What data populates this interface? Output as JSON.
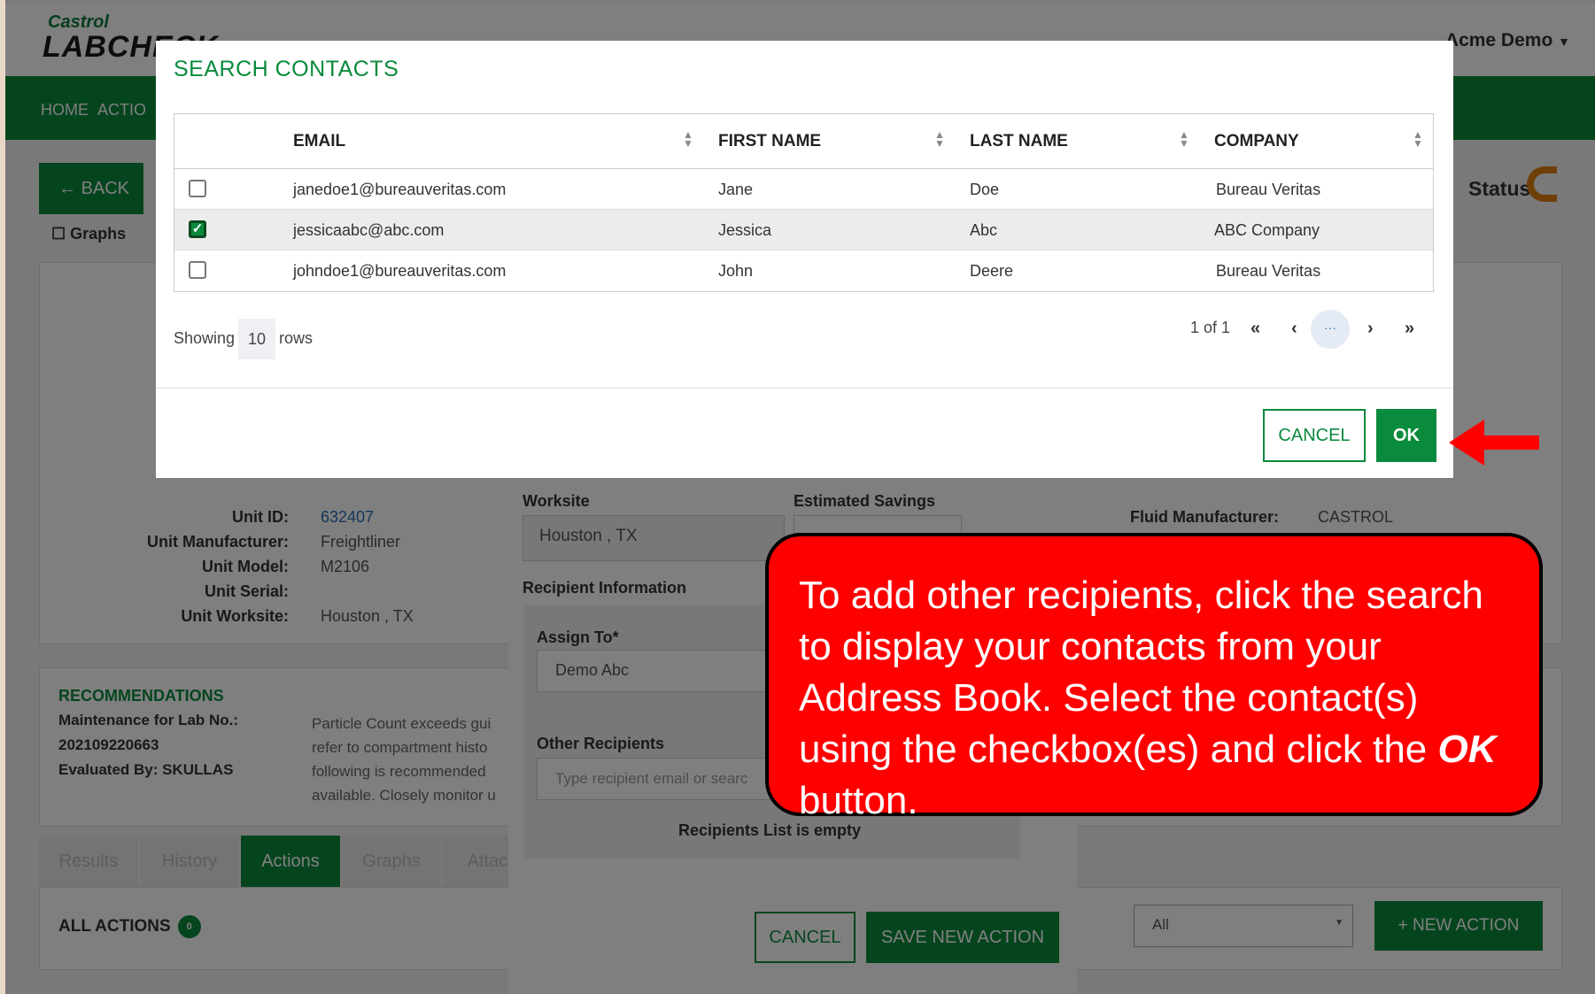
{
  "app": {
    "brand_top": "Castrol",
    "brand_main": "LABCHECK",
    "user": "Acme Demo",
    "nav": [
      "HOME",
      "ACTIO"
    ],
    "back_label": "BACK",
    "graphs_label": "Graphs",
    "status_label": "Status"
  },
  "unit_info": {
    "fields": [
      {
        "label": "Unit ID:",
        "value": "632407"
      },
      {
        "label": "Unit Manufacturer:",
        "value": "Freightliner"
      },
      {
        "label": "Unit Model:",
        "value": "M2106"
      },
      {
        "label": "Unit Serial:",
        "value": ""
      },
      {
        "label": "Unit Worksite:",
        "value": "Houston , TX"
      }
    ]
  },
  "fluid_info": {
    "label": "Fluid Manufacturer:",
    "value": "CASTROL"
  },
  "recommendations": {
    "title": "RECOMMENDATIONS",
    "line1": "Maintenance for Lab No.:",
    "line2": "202109220663",
    "line3": "Evaluated By: SKULLAS",
    "text": "Particle Count exceeds gui refer to compartment histo following is recommended available. Closely monitor u"
  },
  "tabs": [
    "Results",
    "History",
    "Actions",
    "Graphs",
    "Attach"
  ],
  "actions": {
    "title": "ALL ACTIONS",
    "count": "0",
    "filter": "All",
    "new_action": "+ NEW ACTION"
  },
  "new_action_modal": {
    "worksite_label": "Worksite",
    "worksite_value": "Houston , TX",
    "savings_label": "Estimated Savings",
    "recipient_info": "Recipient Information",
    "assign_label": "Assign To*",
    "assign_value": "Demo Abc",
    "other_label": "Other Recipients",
    "other_placeholder": "Type recipient email or searc",
    "empty_text": "Recipients List is empty",
    "cancel": "CANCEL",
    "save": "SAVE NEW ACTION"
  },
  "search_modal": {
    "title": "SEARCH CONTACTS",
    "columns": [
      "EMAIL",
      "FIRST NAME",
      "LAST NAME",
      "COMPANY"
    ],
    "rows": [
      {
        "email": "janedoe1@bureauveritas.com",
        "first": "Jane",
        "last": "Doe",
        "company": "Bureau Veritas",
        "checked": false
      },
      {
        "email": "jessicaabc@abc.com",
        "first": "Jessica",
        "last": "Abc",
        "company": "ABC Company",
        "checked": true
      },
      {
        "email": "johndoe1@bureauveritas.com",
        "first": "John",
        "last": "Deere",
        "company": "Bureau Veritas",
        "checked": false
      }
    ],
    "showing_label": "Showing",
    "rows_count": "10",
    "rows_label": "rows",
    "page_info": "1 of 1",
    "first_icon": "«",
    "prev_icon": "‹",
    "current_page": "···",
    "next_icon": "›",
    "last_icon": "»",
    "cancel": "CANCEL",
    "ok": "OK"
  },
  "callout": {
    "text_before": "To add other recipients, click the search to display your contacts from your Address Book. Select the contact(s) using the checkbox(es) and click the",
    "ok_word": "OK",
    "text_after": "button."
  },
  "colors": {
    "brand_green": "#0a8a3c",
    "callout_red": "#ff0000",
    "status_orange": "#e07f10"
  }
}
